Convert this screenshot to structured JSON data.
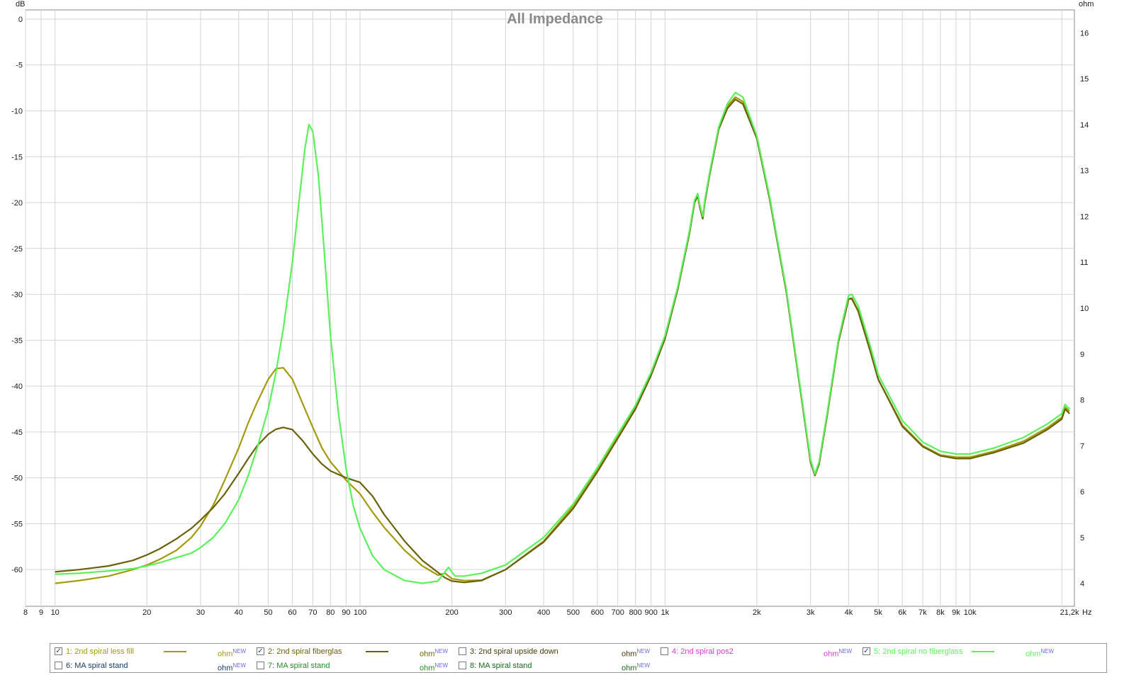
{
  "chart_data": {
    "type": "line",
    "title": "All Impedance",
    "xlabel_unit": "Hz",
    "ylabel_left_unit": "dB",
    "ylabel_right_unit": "ohm",
    "x_scale": "log",
    "xlim": [
      8,
      22000
    ],
    "ylim_left": [
      -64,
      1
    ],
    "ylim_right": [
      3.5,
      16.5
    ],
    "grid": true,
    "x_ticks": [
      {
        "v": 8,
        "l": "8"
      },
      {
        "v": 9,
        "l": "9"
      },
      {
        "v": 10,
        "l": "10"
      },
      {
        "v": 20,
        "l": "20"
      },
      {
        "v": 30,
        "l": "30"
      },
      {
        "v": 40,
        "l": "40"
      },
      {
        "v": 50,
        "l": "50"
      },
      {
        "v": 60,
        "l": "60"
      },
      {
        "v": 70,
        "l": "70"
      },
      {
        "v": 80,
        "l": "80"
      },
      {
        "v": 90,
        "l": "90"
      },
      {
        "v": 100,
        "l": "100"
      },
      {
        "v": 200,
        "l": "200"
      },
      {
        "v": 300,
        "l": "300"
      },
      {
        "v": 400,
        "l": "400"
      },
      {
        "v": 500,
        "l": "500"
      },
      {
        "v": 600,
        "l": "600"
      },
      {
        "v": 700,
        "l": "700"
      },
      {
        "v": 800,
        "l": "800"
      },
      {
        "v": 900,
        "l": "900"
      },
      {
        "v": 1000,
        "l": "1k"
      },
      {
        "v": 2000,
        "l": "2k"
      },
      {
        "v": 3000,
        "l": "3k"
      },
      {
        "v": 4000,
        "l": "4k"
      },
      {
        "v": 5000,
        "l": "5k"
      },
      {
        "v": 6000,
        "l": "6k"
      },
      {
        "v": 7000,
        "l": "7k"
      },
      {
        "v": 8000,
        "l": "8k"
      },
      {
        "v": 9000,
        "l": "9k"
      },
      {
        "v": 10000,
        "l": "10k"
      },
      {
        "v": 21200,
        "l": "21,2k"
      }
    ],
    "y_ticks_left": [
      0,
      -5,
      -10,
      -15,
      -20,
      -25,
      -30,
      -35,
      -40,
      -45,
      -50,
      -55,
      -60
    ],
    "y_ticks_right": [
      16,
      15,
      14,
      13,
      12,
      11,
      10,
      9,
      8,
      7,
      6,
      5,
      4
    ],
    "series": [
      {
        "name": "1: 2nd spiral less fill",
        "color": "#a39a0c",
        "unit": "ohm",
        "x": [
          10,
          12,
          15,
          18,
          20,
          22,
          25,
          28,
          30,
          33,
          36,
          40,
          43,
          46,
          50,
          53,
          56,
          60,
          65,
          70,
          75,
          80,
          90,
          100,
          110,
          120,
          140,
          160,
          180,
          190,
          200,
          220,
          250,
          300,
          400,
          500,
          600,
          700,
          800,
          900,
          1000,
          1100,
          1200,
          1250,
          1280,
          1300,
          1330,
          1350,
          1400,
          1500,
          1600,
          1700,
          1800,
          2000,
          2200,
          2500,
          2800,
          3000,
          3100,
          3200,
          3400,
          3700,
          4000,
          4100,
          4300,
          4700,
          5000,
          6000,
          7000,
          8000,
          9000,
          10000,
          12000,
          15000,
          18000,
          20000,
          20500,
          21200
        ],
        "y": [
          4.0,
          4.06,
          4.16,
          4.3,
          4.4,
          4.52,
          4.72,
          5.0,
          5.25,
          5.7,
          6.25,
          6.95,
          7.5,
          7.95,
          8.45,
          8.68,
          8.7,
          8.45,
          7.9,
          7.4,
          6.95,
          6.65,
          6.25,
          5.95,
          5.55,
          5.22,
          4.72,
          4.38,
          4.18,
          4.22,
          4.1,
          4.06,
          4.07,
          4.3,
          4.92,
          5.68,
          6.48,
          7.2,
          7.83,
          8.55,
          9.35,
          10.4,
          11.6,
          12.3,
          12.45,
          12.2,
          11.95,
          12.3,
          12.9,
          13.9,
          14.4,
          14.6,
          14.5,
          13.7,
          12.4,
          10.35,
          8.05,
          6.65,
          6.35,
          6.6,
          7.65,
          9.25,
          10.2,
          10.22,
          9.95,
          9.1,
          8.45,
          7.45,
          7.0,
          6.8,
          6.75,
          6.75,
          6.88,
          7.1,
          7.4,
          7.62,
          7.84,
          7.75
        ]
      },
      {
        "name": "2: 2nd spiral fiberglas",
        "color": "#6a6208",
        "unit": "ohm",
        "x": [
          10,
          12,
          15,
          18,
          20,
          22,
          25,
          28,
          30,
          33,
          36,
          40,
          43,
          46,
          50,
          53,
          56,
          60,
          65,
          70,
          75,
          80,
          90,
          100,
          110,
          120,
          140,
          160,
          180,
          190,
          200,
          220,
          250,
          300,
          400,
          500,
          600,
          700,
          800,
          900,
          1000,
          1100,
          1200,
          1250,
          1280,
          1300,
          1330,
          1350,
          1400,
          1500,
          1600,
          1700,
          1800,
          2000,
          2200,
          2500,
          2800,
          3000,
          3100,
          3200,
          3400,
          3700,
          4000,
          4100,
          4300,
          4700,
          5000,
          6000,
          7000,
          8000,
          9000,
          10000,
          12000,
          15000,
          18000,
          20000,
          20500,
          21200
        ],
        "y": [
          4.25,
          4.3,
          4.38,
          4.5,
          4.62,
          4.75,
          4.97,
          5.2,
          5.38,
          5.65,
          5.95,
          6.4,
          6.72,
          7.0,
          7.25,
          7.36,
          7.4,
          7.35,
          7.1,
          6.82,
          6.6,
          6.45,
          6.3,
          6.2,
          5.9,
          5.5,
          4.92,
          4.5,
          4.24,
          4.12,
          4.05,
          4.02,
          4.06,
          4.3,
          4.9,
          5.63,
          6.43,
          7.16,
          7.8,
          8.53,
          9.33,
          10.4,
          11.6,
          12.3,
          12.45,
          12.2,
          11.95,
          12.3,
          12.9,
          13.9,
          14.35,
          14.55,
          14.45,
          13.7,
          12.4,
          10.35,
          8.05,
          6.65,
          6.35,
          6.6,
          7.65,
          9.25,
          10.2,
          10.2,
          9.93,
          9.08,
          8.45,
          7.42,
          6.98,
          6.78,
          6.72,
          6.72,
          6.85,
          7.06,
          7.36,
          7.58,
          7.8,
          7.7
        ]
      },
      {
        "name": "3: 2nd spiral upside down",
        "color": "#4a3a08",
        "unit": "ohm",
        "x": [],
        "y": []
      },
      {
        "name": "4: 2nd spiral pos2",
        "color": "#d83ad8",
        "unit": "ohm",
        "x": [],
        "y": []
      },
      {
        "name": "5: 2nd spiral no fiberglass",
        "color": "#5cf05c",
        "unit": "ohm",
        "x": [
          10,
          12,
          15,
          18,
          20,
          22,
          25,
          28,
          30,
          33,
          36,
          40,
          43,
          46,
          50,
          53,
          56,
          60,
          63,
          66,
          68,
          70,
          73,
          76,
          80,
          85,
          90,
          95,
          100,
          110,
          120,
          140,
          160,
          180,
          195,
          200,
          205,
          220,
          250,
          300,
          400,
          500,
          600,
          700,
          800,
          900,
          1000,
          1100,
          1200,
          1250,
          1280,
          1300,
          1330,
          1350,
          1400,
          1500,
          1600,
          1700,
          1800,
          2000,
          2200,
          2500,
          2800,
          3000,
          3100,
          3200,
          3400,
          3700,
          4000,
          4100,
          4300,
          4700,
          5000,
          6000,
          7000,
          8000,
          9000,
          10000,
          12000,
          15000,
          18000,
          20000,
          20500,
          21200
        ],
        "y": [
          4.2,
          4.22,
          4.27,
          4.32,
          4.38,
          4.45,
          4.56,
          4.66,
          4.78,
          5.0,
          5.3,
          5.82,
          6.35,
          6.95,
          7.8,
          8.6,
          9.55,
          11.0,
          12.3,
          13.5,
          14.0,
          13.85,
          12.9,
          11.4,
          9.4,
          7.7,
          6.5,
          5.7,
          5.2,
          4.6,
          4.3,
          4.06,
          4.0,
          4.05,
          4.35,
          4.25,
          4.16,
          4.16,
          4.22,
          4.4,
          5.0,
          5.73,
          6.52,
          7.25,
          7.88,
          8.6,
          9.4,
          10.45,
          11.65,
          12.35,
          12.5,
          12.25,
          12.0,
          12.35,
          12.95,
          13.95,
          14.45,
          14.7,
          14.6,
          13.75,
          12.45,
          10.4,
          8.1,
          6.7,
          6.38,
          6.65,
          7.7,
          9.3,
          10.28,
          10.3,
          10.05,
          9.2,
          8.55,
          7.55,
          7.08,
          6.88,
          6.82,
          6.82,
          6.95,
          7.18,
          7.48,
          7.7,
          7.9,
          7.8
        ]
      },
      {
        "name": "6: MA spiral stand",
        "color": "#1a3a6a",
        "unit": "ohm",
        "x": [],
        "y": []
      },
      {
        "name": "7: MA spiral stand",
        "color": "#2a8a2a",
        "unit": "ohm",
        "x": [],
        "y": []
      },
      {
        "name": "8: MA spiral stand",
        "color": "#1a6a1a",
        "unit": "ohm",
        "x": [],
        "y": []
      }
    ]
  },
  "legend": {
    "new_tag": "NEW",
    "items": [
      {
        "label": "1: 2nd spiral less fill",
        "unit": "ohm",
        "checked": true,
        "text_color": "#a39a0c",
        "line_color": "#a39a0c",
        "show_line": true
      },
      {
        "label": "2: 2nd spiral fiberglas",
        "unit": "ohm",
        "checked": true,
        "text_color": "#6a6208",
        "line_color": "#6a6208",
        "show_line": true
      },
      {
        "label": "3: 2nd spiral upside down",
        "unit": "ohm",
        "checked": false,
        "text_color": "#4a3a08",
        "line_color": "#4a3a08",
        "show_line": false
      },
      {
        "label": "4: 2nd spiral pos2",
        "unit": "ohm",
        "checked": false,
        "text_color": "#d83ad8",
        "line_color": "#d83ad8",
        "show_line": false
      },
      {
        "label": "5: 2nd spiral no fiberglass",
        "unit": "ohm",
        "checked": true,
        "text_color": "#5cf05c",
        "line_color": "#5cf05c",
        "show_line": true
      },
      {
        "label": "6: MA spiral stand",
        "unit": "ohm",
        "checked": false,
        "text_color": "#1a3a6a",
        "line_color": "#1a3a6a",
        "show_line": false
      },
      {
        "label": "7: MA spiral stand",
        "unit": "ohm",
        "checked": false,
        "text_color": "#2a8a2a",
        "line_color": "#2a8a2a",
        "show_line": false
      },
      {
        "label": "8: MA spiral stand",
        "unit": "ohm",
        "checked": false,
        "text_color": "#1a6a1a",
        "line_color": "#1a6a1a",
        "show_line": false
      }
    ]
  }
}
